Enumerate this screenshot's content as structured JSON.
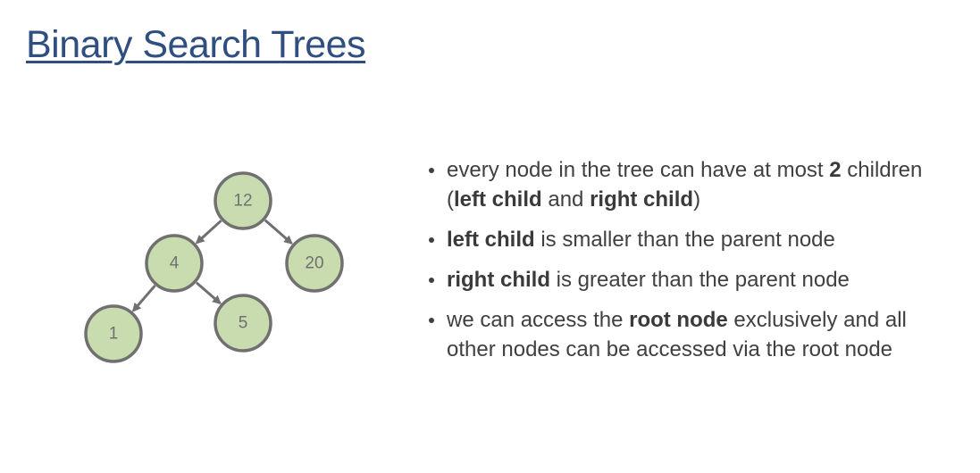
{
  "title": "Binary Search Trees",
  "colors": {
    "title": "#2f4f80",
    "node_fill": "#c8dcb0",
    "node_stroke": "#707070",
    "text": "#404040"
  },
  "tree": {
    "nodes": [
      {
        "id": "n12",
        "label": "12"
      },
      {
        "id": "n4",
        "label": "4"
      },
      {
        "id": "n20",
        "label": "20"
      },
      {
        "id": "n1",
        "label": "1"
      },
      {
        "id": "n5",
        "label": "5"
      }
    ],
    "edges": [
      {
        "from": "n12",
        "to": "n4"
      },
      {
        "from": "n12",
        "to": "n20"
      },
      {
        "from": "n4",
        "to": "n1"
      },
      {
        "from": "n4",
        "to": "n5"
      }
    ]
  },
  "bullets": [
    {
      "parts": [
        {
          "text": "every node in the tree can have at most ",
          "bold": false
        },
        {
          "text": "2",
          "bold": true
        },
        {
          "text": " children (",
          "bold": false
        },
        {
          "text": "left child",
          "bold": true
        },
        {
          "text": " and ",
          "bold": false
        },
        {
          "text": "right child",
          "bold": true
        },
        {
          "text": ")",
          "bold": false
        }
      ]
    },
    {
      "parts": [
        {
          "text": "left child",
          "bold": true
        },
        {
          "text": " is smaller than the parent node",
          "bold": false
        }
      ]
    },
    {
      "parts": [
        {
          "text": "right child",
          "bold": true
        },
        {
          "text": " is greater than the parent node",
          "bold": false
        }
      ]
    },
    {
      "parts": [
        {
          "text": "we can access the ",
          "bold": false
        },
        {
          "text": "root node",
          "bold": true
        },
        {
          "text": " exclusively and all other nodes can be accessed via the root node",
          "bold": false
        }
      ]
    }
  ]
}
